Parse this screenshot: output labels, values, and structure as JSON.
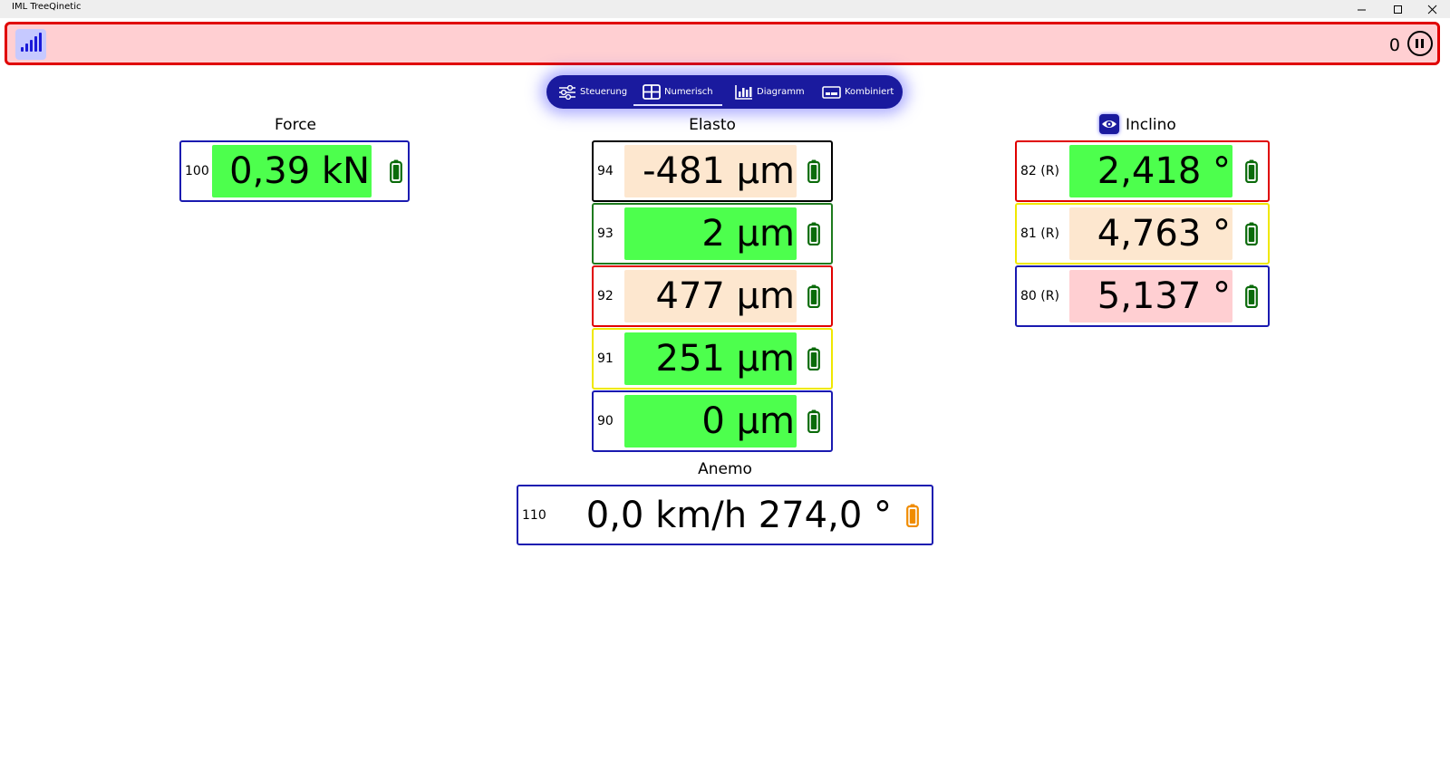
{
  "window": {
    "title": "IML TreeQinetic"
  },
  "status": {
    "counter": "0"
  },
  "nav": {
    "tabs": [
      {
        "label": "Steuerung",
        "icon": "sliders-icon"
      },
      {
        "label": "Numerisch",
        "icon": "grid-icon",
        "active": true
      },
      {
        "label": "Diagramm",
        "icon": "bar-chart-icon"
      },
      {
        "label": "Kombiniert",
        "icon": "combined-icon"
      }
    ]
  },
  "groups": {
    "force": {
      "title": "Force",
      "sensors": [
        {
          "id": "100",
          "value": "0,39 kN",
          "bg": "#4dff4d",
          "frame": "#1a1ab0",
          "battery": "#0b6b0b"
        }
      ]
    },
    "elasto": {
      "title": "Elasto",
      "sensors": [
        {
          "id": "94",
          "value": "-481 µm",
          "bg": "#fde7cf",
          "frame": "#000000",
          "battery": "#0b6b0b"
        },
        {
          "id": "93",
          "value": "2 µm",
          "bg": "#4dff4d",
          "frame": "#1e7a1e",
          "battery": "#0b6b0b"
        },
        {
          "id": "92",
          "value": "477 µm",
          "bg": "#fde7cf",
          "frame": "#e00000",
          "battery": "#0b6b0b"
        },
        {
          "id": "91",
          "value": "251 µm",
          "bg": "#4dff4d",
          "frame": "#f0e800",
          "battery": "#0b6b0b"
        },
        {
          "id": "90",
          "value": "0 µm",
          "bg": "#4dff4d",
          "frame": "#1a1ab0",
          "battery": "#0b6b0b"
        }
      ]
    },
    "inclino": {
      "title": "Inclino",
      "sensors": [
        {
          "id": "82 (R)",
          "value": "2,418 °",
          "bg": "#4dff4d",
          "frame": "#e00000",
          "battery": "#0b6b0b"
        },
        {
          "id": "81 (R)",
          "value": "4,763 °",
          "bg": "#fde7cf",
          "frame": "#f0e800",
          "battery": "#0b6b0b"
        },
        {
          "id": "80 (R)",
          "value": "5,137 °",
          "bg": "#ffcfd2",
          "frame": "#1a1ab0",
          "battery": "#0b6b0b"
        }
      ]
    },
    "anemo": {
      "title": "Anemo",
      "sensors": [
        {
          "id": "110",
          "value": "0,0 km/h 274,0 °",
          "bg": "#ffffff",
          "frame": "#1a1ab0",
          "battery": "#f08c00"
        }
      ]
    }
  }
}
